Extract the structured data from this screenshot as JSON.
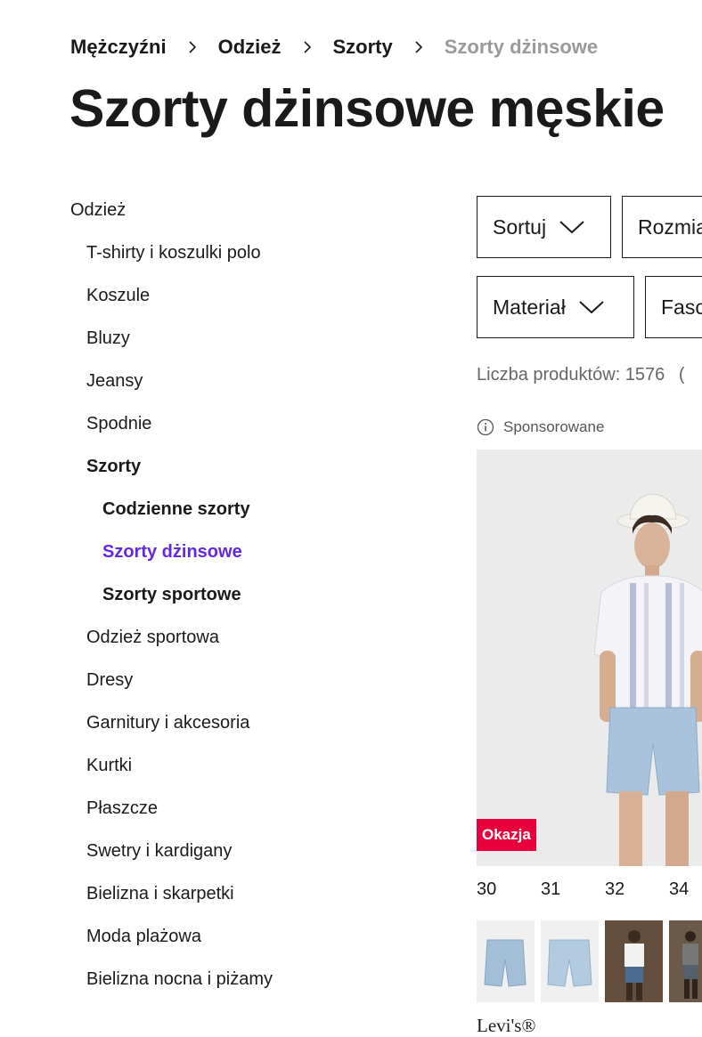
{
  "breadcrumb": {
    "items": [
      {
        "label": "Mężczyźni"
      },
      {
        "label": "Odzież"
      },
      {
        "label": "Szorty"
      },
      {
        "label": "Szorty dżinsowe"
      }
    ]
  },
  "page": {
    "title": "Szorty dżinsowe męskie"
  },
  "sidebar": {
    "items": [
      {
        "label": "Odzież",
        "level": 1
      },
      {
        "label": "T-shirty i koszulki polo",
        "level": 2
      },
      {
        "label": "Koszule",
        "level": 2
      },
      {
        "label": "Bluzy",
        "level": 2
      },
      {
        "label": "Jeansy",
        "level": 2
      },
      {
        "label": "Spodnie",
        "level": 2
      },
      {
        "label": "Szorty",
        "level": 2,
        "bold": true
      },
      {
        "label": "Codzienne szorty",
        "level": 3,
        "bold": true
      },
      {
        "label": "Szorty dżinsowe",
        "level": 3,
        "active": true
      },
      {
        "label": "Szorty sportowe",
        "level": 3,
        "bold": true
      },
      {
        "label": "Odzież sportowa",
        "level": 2
      },
      {
        "label": "Dresy",
        "level": 2
      },
      {
        "label": "Garnitury i akcesoria",
        "level": 2
      },
      {
        "label": "Kurtki",
        "level": 2
      },
      {
        "label": "Płaszcze",
        "level": 2
      },
      {
        "label": "Swetry i kardigany",
        "level": 2
      },
      {
        "label": "Bielizna i skarpetki",
        "level": 2
      },
      {
        "label": "Moda plażowa",
        "level": 2
      },
      {
        "label": "Bielizna nocna i piżamy",
        "level": 2
      }
    ]
  },
  "filters": {
    "sort": {
      "label": "Sortuj"
    },
    "size": {
      "label": "Rozmia"
    },
    "material": {
      "label": "Materiał"
    },
    "fit": {
      "label": "Fasc"
    }
  },
  "results": {
    "count_text": "Liczba produktów: 1576",
    "count_extra": "("
  },
  "product": {
    "sponsored_label": "Sponsorowane",
    "badge": "Okazja",
    "sizes": [
      "30",
      "31",
      "32",
      "34"
    ],
    "brand": "Levi's®"
  },
  "colors": {
    "text": "#1a1a1a",
    "muted": "#9a9a9a",
    "active_link": "#6328e0",
    "deal_badge": "#e8003d"
  },
  "icons": {
    "separator": "chevron-right-icon",
    "dropdown": "chevron-down-icon",
    "info": "info-icon"
  }
}
